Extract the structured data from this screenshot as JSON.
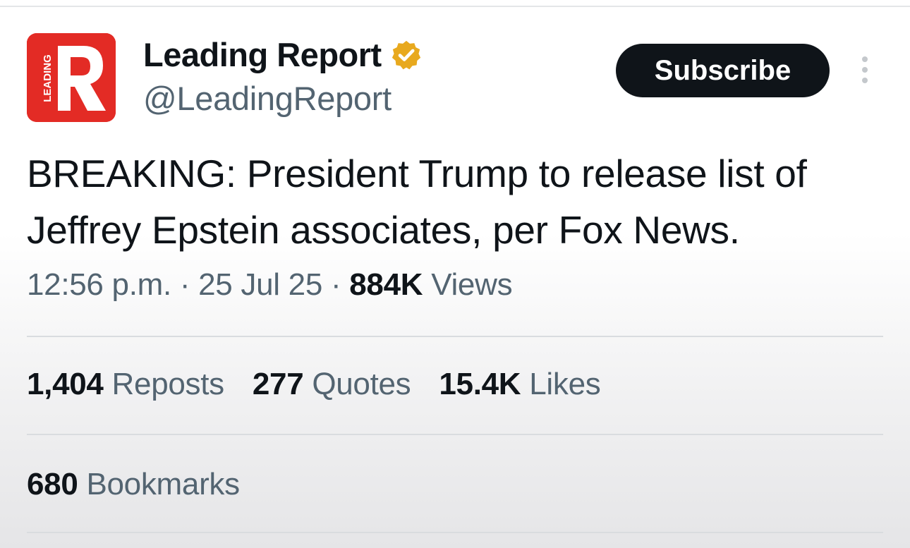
{
  "account": {
    "display_name": "Leading Report",
    "handle": "@LeadingReport",
    "avatar_logo_text": "LEADING R",
    "verified": true,
    "verified_badge_color": "#e8a91e",
    "avatar_color": "#e32b25"
  },
  "actions": {
    "subscribe_label": "Subscribe",
    "more_icon": "more-vertical-icon"
  },
  "tweet": {
    "text": "BREAKING: President Trump to release list of Jeffrey Epstein associates, per Fox News.",
    "time": "12:56 p.m.",
    "date": "25 Jul 25",
    "separator": "·",
    "views_count": "884K",
    "views_label": "Views"
  },
  "stats": {
    "reposts_count": "1,404",
    "reposts_label": "Reposts",
    "quotes_count": "277",
    "quotes_label": "Quotes",
    "likes_count": "15.4K",
    "likes_label": "Likes",
    "bookmarks_count": "680",
    "bookmarks_label": "Bookmarks"
  }
}
